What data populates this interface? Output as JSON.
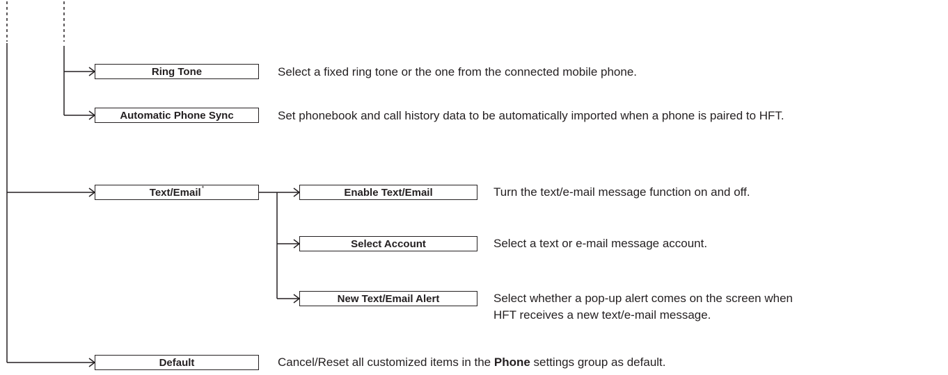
{
  "items": {
    "ring_tone": {
      "label": "Ring Tone",
      "desc": "Select a fixed ring tone or the one from the connected mobile phone."
    },
    "auto_sync": {
      "label": "Automatic Phone Sync",
      "desc": "Set phonebook and call history data to be automatically imported when a phone is paired to HFT."
    },
    "text_email": {
      "label": "Text/Email",
      "mark": "*"
    },
    "enable_text": {
      "label": "Enable Text/Email",
      "desc": "Turn the text/e-mail message function on and off."
    },
    "select_account": {
      "label": "Select Account",
      "desc": "Select a text or e-mail message account."
    },
    "new_alert": {
      "label": "New Text/Email Alert",
      "desc_line1": "Select whether a pop-up alert comes on the screen when",
      "desc_line2": "HFT receives a new text/e-mail message."
    },
    "default": {
      "label": "Default",
      "desc_before": "Cancel/Reset all customized items in the ",
      "desc_bold": "Phone",
      "desc_after": " settings group as default."
    }
  }
}
